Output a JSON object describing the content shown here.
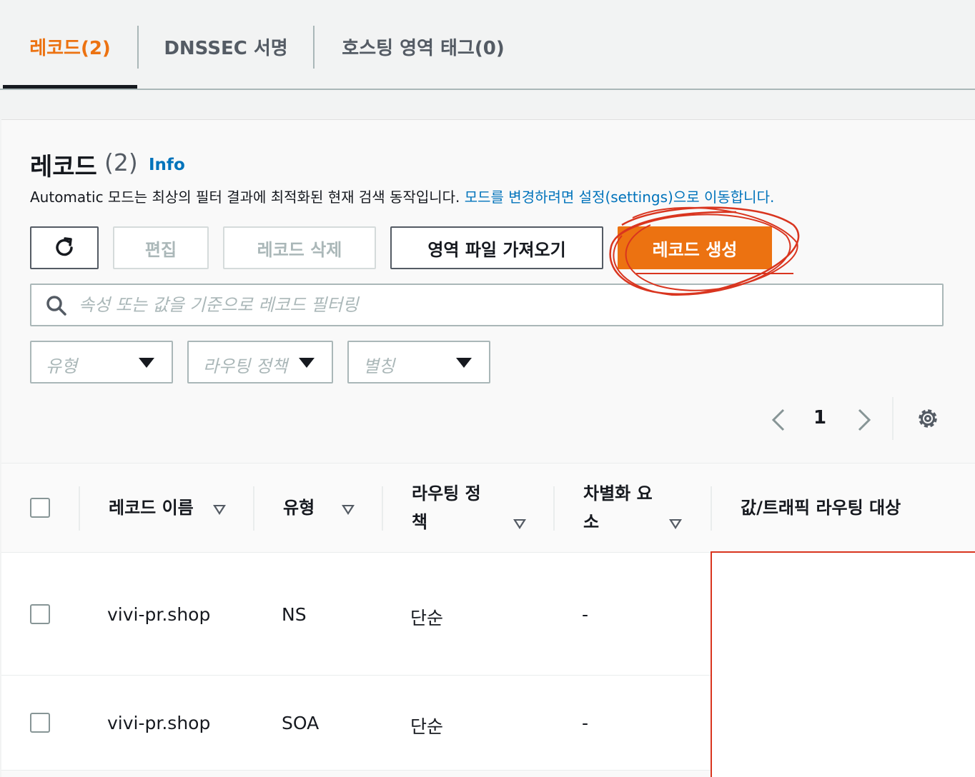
{
  "tabs": [
    {
      "label": "레코드(2)",
      "active": true
    },
    {
      "label": "DNSSEC 서명",
      "active": false
    },
    {
      "label": "호스팅 영역 태그(0)",
      "active": false
    }
  ],
  "panel": {
    "title": "레코드",
    "count": "(2)",
    "info": "Info",
    "description": "Automatic 모드는 최상의 필터 결과에 최적화된 현재 검색 동작입니다.",
    "description_link": "모드를 변경하려면 설정(settings)으로 이동합니다."
  },
  "toolbar": {
    "refresh_icon": "refresh-icon",
    "edit": "편집",
    "delete": "레코드 삭제",
    "import": "영역 파일 가져오기",
    "create": "레코드 생성"
  },
  "search": {
    "placeholder": "속성 또는 값을 기준으로 레코드 필터링"
  },
  "filters": {
    "type": "유형",
    "routing_policy": "라우팅 정책",
    "alias": "별칭"
  },
  "pagination": {
    "current_page": "1"
  },
  "table": {
    "headers": {
      "name": "레코드 이름",
      "type": "유형",
      "policy_line1": "라우팅 정",
      "policy_line2": "책",
      "diff_line1": "차별화 요",
      "diff_line2": "소",
      "value": "값/트래픽 라우팅 대상"
    },
    "rows": [
      {
        "name": "vivi-pr.shop",
        "type": "NS",
        "policy": "단순",
        "diff": "-"
      },
      {
        "name": "vivi-pr.shop",
        "type": "SOA",
        "policy": "단순",
        "diff": "-"
      }
    ]
  },
  "colors": {
    "accent": "#ec7211",
    "link": "#0073bb",
    "annotation": "#d9351f"
  }
}
